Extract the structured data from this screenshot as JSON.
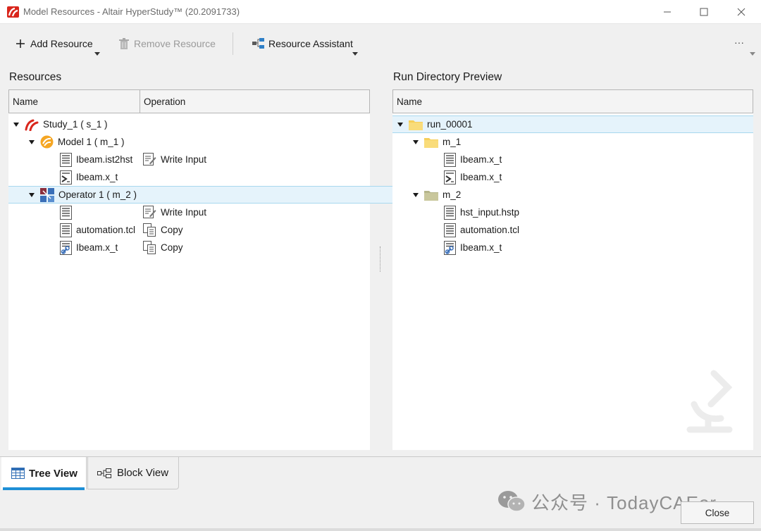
{
  "window": {
    "title": "Model Resources - Altair HyperStudy™ (20.2091733)"
  },
  "toolbar": {
    "add_resource": "Add Resource",
    "remove_resource": "Remove Resource",
    "resource_assistant": "Resource Assistant",
    "more": "···"
  },
  "resources": {
    "label": "Resources",
    "columns": [
      "Name",
      "Operation"
    ],
    "rows": [
      {
        "name": "Study_1 ( s_1 )",
        "operation": ""
      },
      {
        "name": "Model 1 ( m_1 )",
        "operation": ""
      },
      {
        "name": "Ibeam.ist2hst",
        "operation": "Write Input"
      },
      {
        "name": "Ibeam.x_t",
        "operation": ""
      },
      {
        "name": "Operator 1 ( m_2 )",
        "operation": ""
      },
      {
        "name": "",
        "operation": "Write Input"
      },
      {
        "name": "automation.tcl",
        "operation": "Copy"
      },
      {
        "name": "Ibeam.x_t",
        "operation": "Copy"
      }
    ]
  },
  "preview": {
    "label": "Run Directory Preview",
    "columns": [
      "Name"
    ],
    "rows": [
      {
        "name": "run_00001"
      },
      {
        "name": "m_1"
      },
      {
        "name": "Ibeam.x_t"
      },
      {
        "name": "Ibeam.x_t"
      },
      {
        "name": "m_2"
      },
      {
        "name": "hst_input.hstp"
      },
      {
        "name": "automation.tcl"
      },
      {
        "name": "Ibeam.x_t"
      }
    ]
  },
  "tabs": {
    "tree_view": "Tree View",
    "block_view": "Block View"
  },
  "footer": {
    "watermark": "公众号 · TodayCAEer",
    "close": "Close"
  },
  "colors": {
    "selection": "#e5f3fb",
    "accent": "#1e8fd6",
    "altair_red": "#d9261c",
    "model_orange": "#f5a623",
    "folder_yellow": "#f6cf5a"
  }
}
